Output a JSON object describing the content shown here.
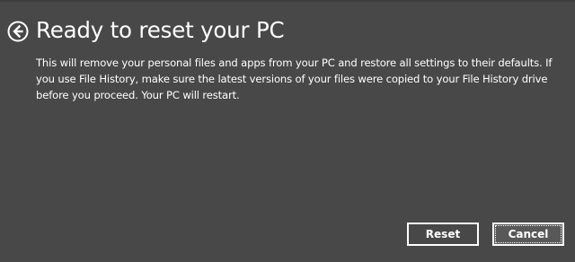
{
  "dialog": {
    "title": "Ready to reset your PC",
    "description": "This will remove your personal files and apps from your PC and restore all settings to their defaults. If you use File History, make sure the latest versions of your files were copied to your File History drive before you proceed. Your PC will restart.",
    "back_icon": "back-arrow-circle-icon"
  },
  "buttons": {
    "reset_label": "Reset",
    "cancel_label": "Cancel"
  },
  "colors": {
    "background": "#484848",
    "text": "#ffffff",
    "button_border": "#ffffff"
  }
}
